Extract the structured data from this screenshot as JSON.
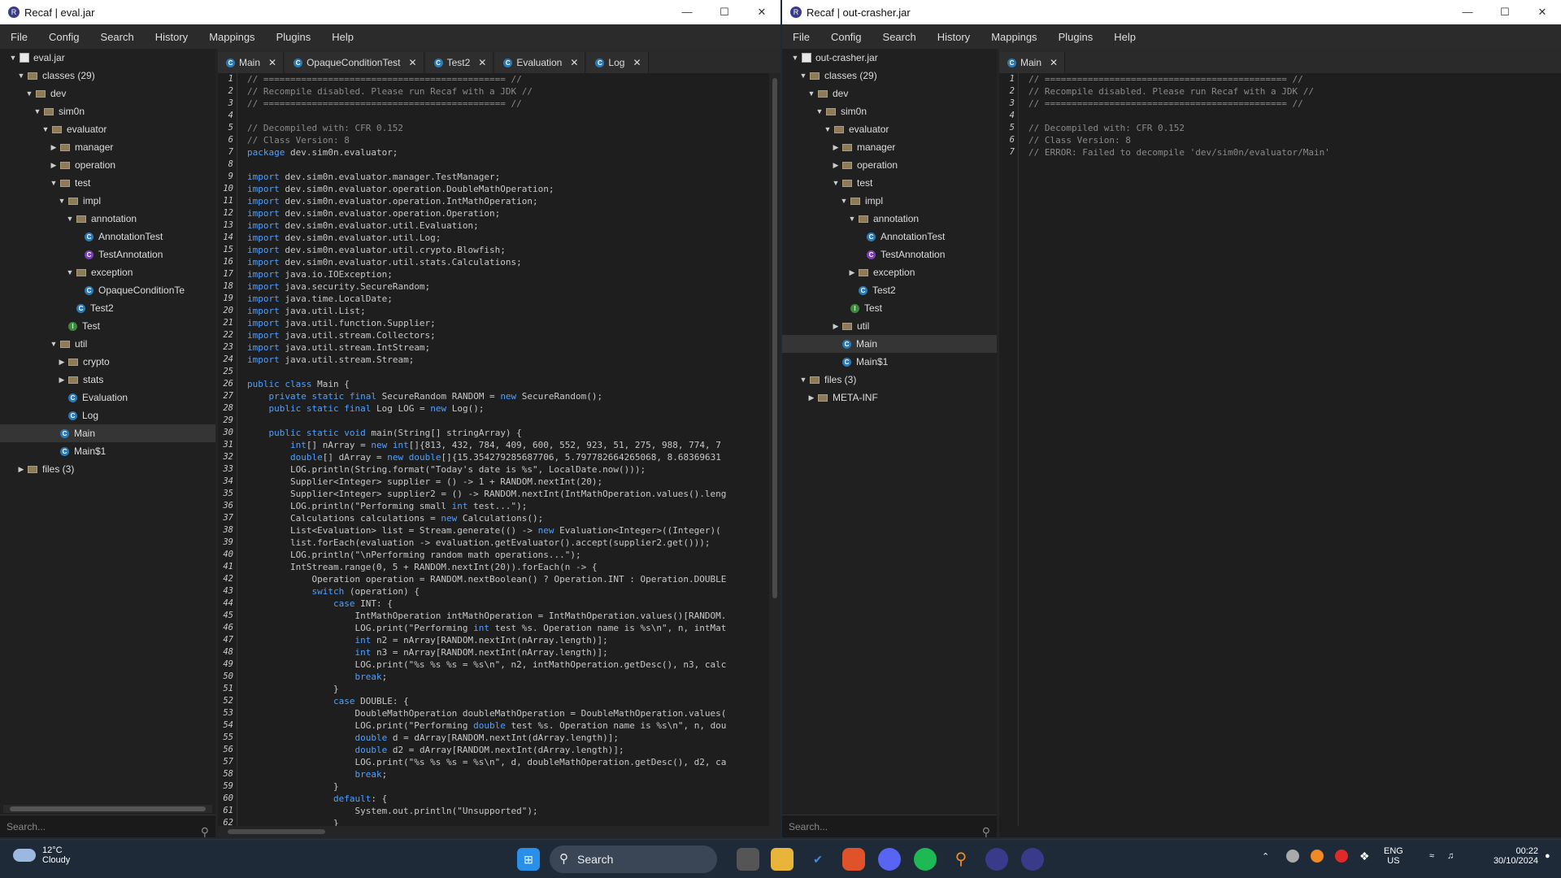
{
  "w1": {
    "title": "Recaf | eval.jar",
    "menu": [
      "File",
      "Config",
      "Search",
      "History",
      "Mappings",
      "Plugins",
      "Help"
    ],
    "tree": [
      {
        "label": "eval.jar",
        "type": "jar",
        "d": 0,
        "caret": "down"
      },
      {
        "label": "classes (29)",
        "type": "pkg",
        "d": 1,
        "caret": "down"
      },
      {
        "label": "dev",
        "type": "folder",
        "d": 2,
        "caret": "down"
      },
      {
        "label": "sim0n",
        "type": "folder",
        "d": 3,
        "caret": "down"
      },
      {
        "label": "evaluator",
        "type": "folder",
        "d": 4,
        "caret": "down"
      },
      {
        "label": "manager",
        "type": "folder",
        "d": 5,
        "caret": "right"
      },
      {
        "label": "operation",
        "type": "folder",
        "d": 5,
        "caret": "right"
      },
      {
        "label": "test",
        "type": "folder",
        "d": 5,
        "caret": "down"
      },
      {
        "label": "impl",
        "type": "folder",
        "d": 6,
        "caret": "down"
      },
      {
        "label": "annotation",
        "type": "folder",
        "d": 7,
        "caret": "down"
      },
      {
        "label": "AnnotationTest",
        "type": "c",
        "d": 8,
        "caret": ""
      },
      {
        "label": "TestAnnotation",
        "type": "a",
        "d": 8,
        "caret": ""
      },
      {
        "label": "exception",
        "type": "folder",
        "d": 7,
        "caret": "down"
      },
      {
        "label": "OpaqueConditionTe",
        "type": "c",
        "d": 8,
        "caret": ""
      },
      {
        "label": "Test2",
        "type": "c",
        "d": 7,
        "caret": ""
      },
      {
        "label": "Test",
        "type": "i",
        "d": 6,
        "caret": ""
      },
      {
        "label": "util",
        "type": "folder",
        "d": 5,
        "caret": "down"
      },
      {
        "label": "crypto",
        "type": "folder",
        "d": 6,
        "caret": "right"
      },
      {
        "label": "stats",
        "type": "folder",
        "d": 6,
        "caret": "right"
      },
      {
        "label": "Evaluation",
        "type": "c",
        "d": 6,
        "caret": ""
      },
      {
        "label": "Log",
        "type": "c",
        "d": 6,
        "caret": ""
      },
      {
        "label": "Main",
        "type": "c",
        "d": 5,
        "caret": "",
        "sel": true
      },
      {
        "label": "Main$1",
        "type": "c",
        "d": 5,
        "caret": ""
      },
      {
        "label": "files  (3)",
        "type": "pkg",
        "d": 1,
        "caret": "right"
      }
    ],
    "search_placeholder": "Search...",
    "tabs": [
      "Main",
      "OpaqueConditionTest",
      "Test2",
      "Evaluation",
      "Log"
    ],
    "code": [
      "// ============================================= //",
      "// Recompile disabled. Please run Recaf with a JDK //",
      "// ============================================= //",
      "",
      "// Decompiled with: CFR 0.152",
      "// Class Version: 8",
      "package dev.sim0n.evaluator;",
      "",
      "import dev.sim0n.evaluator.manager.TestManager;",
      "import dev.sim0n.evaluator.operation.DoubleMathOperation;",
      "import dev.sim0n.evaluator.operation.IntMathOperation;",
      "import dev.sim0n.evaluator.operation.Operation;",
      "import dev.sim0n.evaluator.util.Evaluation;",
      "import dev.sim0n.evaluator.util.Log;",
      "import dev.sim0n.evaluator.util.crypto.Blowfish;",
      "import dev.sim0n.evaluator.util.stats.Calculations;",
      "import java.io.IOException;",
      "import java.security.SecureRandom;",
      "import java.time.LocalDate;",
      "import java.util.List;",
      "import java.util.function.Supplier;",
      "import java.util.stream.Collectors;",
      "import java.util.stream.IntStream;",
      "import java.util.stream.Stream;",
      "",
      "public class Main {",
      "    private static final SecureRandom RANDOM = new SecureRandom();",
      "    public static final Log LOG = new Log();",
      "",
      "    public static void main(String[] stringArray) {",
      "        int[] nArray = new int[]{813, 432, 784, 409, 600, 552, 923, 51, 275, 988, 774, 7",
      "        double[] dArray = new double[]{15.354279285687706, 5.797782664265068, 8.68369631",
      "        LOG.println(String.format(\"Today's date is %s\", LocalDate.now()));",
      "        Supplier<Integer> supplier = () -> 1 + RANDOM.nextInt(20);",
      "        Supplier<Integer> supplier2 = () -> RANDOM.nextInt(IntMathOperation.values().leng",
      "        LOG.println(\"Performing small int test...\");",
      "        Calculations calculations = new Calculations();",
      "        List<Evaluation> list = Stream.generate(() -> new Evaluation<Integer>((Integer)(",
      "        list.forEach(evaluation -> evaluation.getEvaluator().accept(supplier2.get()));",
      "        LOG.println(\"\\nPerforming random math operations...\");",
      "        IntStream.range(0, 5 + RANDOM.nextInt(20)).forEach(n -> {",
      "            Operation operation = RANDOM.nextBoolean() ? Operation.INT : Operation.DOUBLE",
      "            switch (operation) {",
      "                case INT: {",
      "                    IntMathOperation intMathOperation = IntMathOperation.values()[RANDOM.",
      "                    LOG.print(\"Performing int test %s. Operation name is %s\\n\", n, intMat",
      "                    int n2 = nArray[RANDOM.nextInt(nArray.length)];",
      "                    int n3 = nArray[RANDOM.nextInt(nArray.length)];",
      "                    LOG.print(\"%s %s %s = %s\\n\", n2, intMathOperation.getDesc(), n3, calc",
      "                    break;",
      "                }",
      "                case DOUBLE: {",
      "                    DoubleMathOperation doubleMathOperation = DoubleMathOperation.values(",
      "                    LOG.print(\"Performing double test %s. Operation name is %s\\n\", n, dou",
      "                    double d = dArray[RANDOM.nextInt(dArray.length)];",
      "                    double d2 = dArray[RANDOM.nextInt(dArray.length)];",
      "                    LOG.print(\"%s %s %s = %s\\n\", d, doubleMathOperation.getDesc(), d2, ca",
      "                    break;",
      "                }",
      "                default: {",
      "                    System.out.println(\"Unsupported\");",
      "                }"
    ]
  },
  "w2": {
    "title": "Recaf | out-crasher.jar",
    "menu": [
      "File",
      "Config",
      "Search",
      "History",
      "Mappings",
      "Plugins",
      "Help"
    ],
    "tree": [
      {
        "label": "out-crasher.jar",
        "type": "jar",
        "d": 0,
        "caret": "down"
      },
      {
        "label": "classes (29)",
        "type": "pkg",
        "d": 1,
        "caret": "down"
      },
      {
        "label": "dev",
        "type": "folder",
        "d": 2,
        "caret": "down"
      },
      {
        "label": "sim0n",
        "type": "folder",
        "d": 3,
        "caret": "down"
      },
      {
        "label": "evaluator",
        "type": "folder",
        "d": 4,
        "caret": "down"
      },
      {
        "label": "manager",
        "type": "folder",
        "d": 5,
        "caret": "right"
      },
      {
        "label": "operation",
        "type": "folder",
        "d": 5,
        "caret": "right"
      },
      {
        "label": "test",
        "type": "folder",
        "d": 5,
        "caret": "down"
      },
      {
        "label": "impl",
        "type": "folder",
        "d": 6,
        "caret": "down"
      },
      {
        "label": "annotation",
        "type": "folder",
        "d": 7,
        "caret": "down"
      },
      {
        "label": "AnnotationTest",
        "type": "c",
        "d": 8,
        "caret": ""
      },
      {
        "label": "TestAnnotation",
        "type": "a",
        "d": 8,
        "caret": ""
      },
      {
        "label": "exception",
        "type": "folder",
        "d": 7,
        "caret": "right"
      },
      {
        "label": "Test2",
        "type": "c",
        "d": 7,
        "caret": ""
      },
      {
        "label": "Test",
        "type": "i",
        "d": 6,
        "caret": ""
      },
      {
        "label": "util",
        "type": "folder",
        "d": 5,
        "caret": "right"
      },
      {
        "label": "Main",
        "type": "c",
        "d": 5,
        "caret": "",
        "sel": true
      },
      {
        "label": "Main$1",
        "type": "c",
        "d": 5,
        "caret": ""
      },
      {
        "label": "files  (3)",
        "type": "pkg",
        "d": 1,
        "caret": "down"
      },
      {
        "label": "META-INF",
        "type": "folder",
        "d": 2,
        "caret": "right"
      }
    ],
    "search_placeholder": "Search...",
    "tabs": [
      "Main"
    ],
    "code": [
      "// ============================================= //",
      "// Recompile disabled. Please run Recaf with a JDK //",
      "// ============================================= //",
      "",
      "// Decompiled with: CFR 0.152",
      "// Class Version: 8",
      "// ERROR: Failed to decompile 'dev/sim0n/evaluator/Main'"
    ]
  },
  "taskbar": {
    "temp": "12°C",
    "weather": "Cloudy",
    "search": "Search",
    "lang": "ENG",
    "region": "US",
    "time": "00:22",
    "date": "30/10/2024"
  }
}
